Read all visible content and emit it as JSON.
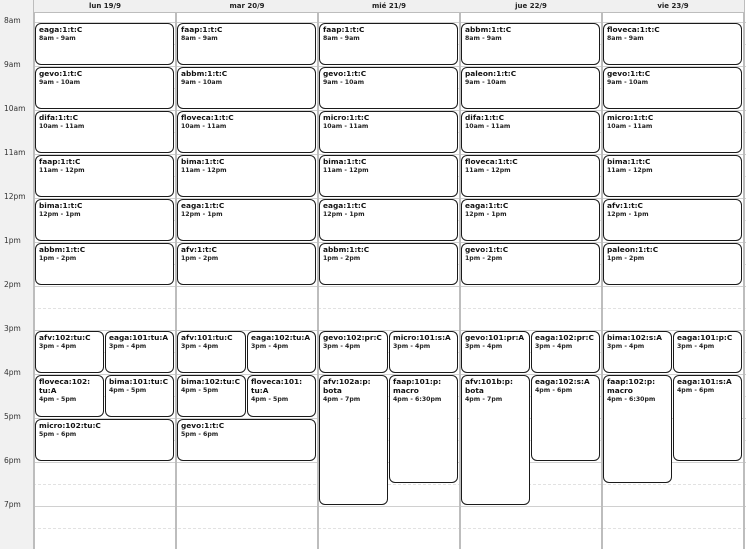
{
  "calendar": {
    "days": [
      {
        "label": "lun 19/9"
      },
      {
        "label": "mar 20/9"
      },
      {
        "label": "mié 21/9"
      },
      {
        "label": "jue 22/9"
      },
      {
        "label": "vie 23/9"
      }
    ],
    "hours": [
      "8am",
      "9am",
      "10am",
      "11am",
      "12pm",
      "1pm",
      "2pm",
      "3pm",
      "4pm",
      "5pm",
      "6pm",
      "7pm"
    ],
    "events": [
      {
        "day": 0,
        "title": "eaga:1:t:C",
        "time": "8am - 9am",
        "start": 8,
        "end": 9
      },
      {
        "day": 0,
        "title": "gevo:1:t:C",
        "time": "9am - 10am",
        "start": 9,
        "end": 10
      },
      {
        "day": 0,
        "title": "difa:1:t:C",
        "time": "10am - 11am",
        "start": 10,
        "end": 11
      },
      {
        "day": 0,
        "title": "faap:1:t:C",
        "time": "11am - 12pm",
        "start": 11,
        "end": 12
      },
      {
        "day": 0,
        "title": "bima:1:t:C",
        "time": "12pm - 1pm",
        "start": 12,
        "end": 13
      },
      {
        "day": 0,
        "title": "abbm:1:t:C",
        "time": "1pm - 2pm",
        "start": 13,
        "end": 14
      },
      {
        "day": 0,
        "title": "afv:102:tu:C",
        "time": "3pm - 4pm",
        "start": 15,
        "end": 16,
        "sub": 0,
        "subs": 2
      },
      {
        "day": 0,
        "title": "eaga:101:tu:A",
        "time": "3pm - 4pm",
        "start": 15,
        "end": 16,
        "sub": 1,
        "subs": 2
      },
      {
        "day": 0,
        "title": "floveca:102:\ntu:A",
        "time": "4pm - 5pm",
        "start": 16,
        "end": 17,
        "sub": 0,
        "subs": 2
      },
      {
        "day": 0,
        "title": "bima:101:tu:C",
        "time": "4pm - 5pm",
        "start": 16,
        "end": 17,
        "sub": 1,
        "subs": 2
      },
      {
        "day": 0,
        "title": "micro:102:tu:C",
        "time": "5pm - 6pm",
        "start": 17,
        "end": 18
      },
      {
        "day": 1,
        "title": "faap:1:t:C",
        "time": "8am - 9am",
        "start": 8,
        "end": 9
      },
      {
        "day": 1,
        "title": "abbm:1:t:C",
        "time": "9am - 10am",
        "start": 9,
        "end": 10
      },
      {
        "day": 1,
        "title": "floveca:1:t:C",
        "time": "10am - 11am",
        "start": 10,
        "end": 11
      },
      {
        "day": 1,
        "title": "bima:1:t:C",
        "time": "11am - 12pm",
        "start": 11,
        "end": 12
      },
      {
        "day": 1,
        "title": "eaga:1:t:C",
        "time": "12pm - 1pm",
        "start": 12,
        "end": 13
      },
      {
        "day": 1,
        "title": "afv:1:t:C",
        "time": "1pm - 2pm",
        "start": 13,
        "end": 14
      },
      {
        "day": 1,
        "title": "afv:101:tu:C",
        "time": "3pm - 4pm",
        "start": 15,
        "end": 16,
        "sub": 0,
        "subs": 2
      },
      {
        "day": 1,
        "title": "eaga:102:tu:A",
        "time": "3pm - 4pm",
        "start": 15,
        "end": 16,
        "sub": 1,
        "subs": 2
      },
      {
        "day": 1,
        "title": "bima:102:tu:C",
        "time": "4pm - 5pm",
        "start": 16,
        "end": 17,
        "sub": 0,
        "subs": 2
      },
      {
        "day": 1,
        "title": "floveca:101:\ntu:A",
        "time": "4pm - 5pm",
        "start": 16,
        "end": 17,
        "sub": 1,
        "subs": 2
      },
      {
        "day": 1,
        "title": "gevo:1:t:C",
        "time": "5pm - 6pm",
        "start": 17,
        "end": 18
      },
      {
        "day": 2,
        "title": "faap:1:t:C",
        "time": "8am - 9am",
        "start": 8,
        "end": 9
      },
      {
        "day": 2,
        "title": "gevo:1:t:C",
        "time": "9am - 10am",
        "start": 9,
        "end": 10
      },
      {
        "day": 2,
        "title": "micro:1:t:C",
        "time": "10am - 11am",
        "start": 10,
        "end": 11
      },
      {
        "day": 2,
        "title": "bima:1:t:C",
        "time": "11am - 12pm",
        "start": 11,
        "end": 12
      },
      {
        "day": 2,
        "title": "eaga:1:t:C",
        "time": "12pm - 1pm",
        "start": 12,
        "end": 13
      },
      {
        "day": 2,
        "title": "abbm:1:t:C",
        "time": "1pm - 2pm",
        "start": 13,
        "end": 14
      },
      {
        "day": 2,
        "title": "gevo:102:pr:C",
        "time": "3pm - 4pm",
        "start": 15,
        "end": 16,
        "sub": 0,
        "subs": 2
      },
      {
        "day": 2,
        "title": "micro:101:s:A",
        "time": "3pm - 4pm",
        "start": 15,
        "end": 16,
        "sub": 1,
        "subs": 2
      },
      {
        "day": 2,
        "title": "afv:102a:p:\nbota",
        "time": "4pm - 7pm",
        "start": 16,
        "end": 19,
        "sub": 0,
        "subs": 2
      },
      {
        "day": 2,
        "title": "faap:101:p:\nmacro",
        "time": "4pm - 6:30pm",
        "start": 16,
        "end": 18.5,
        "sub": 1,
        "subs": 2
      },
      {
        "day": 3,
        "title": "abbm:1:t:C",
        "time": "8am - 9am",
        "start": 8,
        "end": 9
      },
      {
        "day": 3,
        "title": "paleon:1:t:C",
        "time": "9am - 10am",
        "start": 9,
        "end": 10
      },
      {
        "day": 3,
        "title": "difa:1:t:C",
        "time": "10am - 11am",
        "start": 10,
        "end": 11
      },
      {
        "day": 3,
        "title": "floveca:1:t:C",
        "time": "11am - 12pm",
        "start": 11,
        "end": 12
      },
      {
        "day": 3,
        "title": "eaga:1:t:C",
        "time": "12pm - 1pm",
        "start": 12,
        "end": 13
      },
      {
        "day": 3,
        "title": "gevo:1:t:C",
        "time": "1pm - 2pm",
        "start": 13,
        "end": 14
      },
      {
        "day": 3,
        "title": "gevo:101:pr:A",
        "time": "3pm - 4pm",
        "start": 15,
        "end": 16,
        "sub": 0,
        "subs": 2
      },
      {
        "day": 3,
        "title": "eaga:102:pr:C",
        "time": "3pm - 4pm",
        "start": 15,
        "end": 16,
        "sub": 1,
        "subs": 2
      },
      {
        "day": 3,
        "title": "afv:101b:p:\nbota",
        "time": "4pm - 7pm",
        "start": 16,
        "end": 19,
        "sub": 0,
        "subs": 2
      },
      {
        "day": 3,
        "title": "eaga:102:s:A",
        "time": "4pm - 6pm",
        "start": 16,
        "end": 18,
        "sub": 1,
        "subs": 2
      },
      {
        "day": 4,
        "title": "floveca:1:t:C",
        "time": "8am - 9am",
        "start": 8,
        "end": 9
      },
      {
        "day": 4,
        "title": "gevo:1:t:C",
        "time": "9am - 10am",
        "start": 9,
        "end": 10
      },
      {
        "day": 4,
        "title": "micro:1:t:C",
        "time": "10am - 11am",
        "start": 10,
        "end": 11
      },
      {
        "day": 4,
        "title": "bima:1:t:C",
        "time": "11am - 12pm",
        "start": 11,
        "end": 12
      },
      {
        "day": 4,
        "title": "afv:1:t:C",
        "time": "12pm - 1pm",
        "start": 12,
        "end": 13
      },
      {
        "day": 4,
        "title": "paleon:1:t:C",
        "time": "1pm - 2pm",
        "start": 13,
        "end": 14
      },
      {
        "day": 4,
        "title": "bima:102:s:A",
        "time": "3pm - 4pm",
        "start": 15,
        "end": 16,
        "sub": 0,
        "subs": 2
      },
      {
        "day": 4,
        "title": "eaga:101:p:C",
        "time": "3pm - 4pm",
        "start": 15,
        "end": 16,
        "sub": 1,
        "subs": 2
      },
      {
        "day": 4,
        "title": "faap:102:p:\nmacro",
        "time": "4pm - 6:30pm",
        "start": 16,
        "end": 18.5,
        "sub": 0,
        "subs": 2
      },
      {
        "day": 4,
        "title": "eaga:101:s:A",
        "time": "4pm - 6pm",
        "start": 16,
        "end": 18,
        "sub": 1,
        "subs": 2
      }
    ]
  }
}
